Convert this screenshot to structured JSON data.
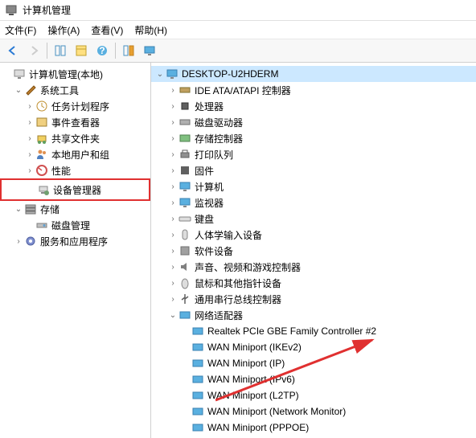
{
  "window": {
    "title": "计算机管理"
  },
  "menu": {
    "file": "文件(F)",
    "action": "操作(A)",
    "view": "查看(V)",
    "help": "帮助(H)"
  },
  "left_tree": {
    "root": "计算机管理(本地)",
    "system_tools": "系统工具",
    "task_scheduler": "任务计划程序",
    "event_viewer": "事件查看器",
    "shared_folders": "共享文件夹",
    "local_users": "本地用户和组",
    "performance": "性能",
    "device_manager": "设备管理器",
    "storage": "存储",
    "disk_management": "磁盘管理",
    "services": "服务和应用程序"
  },
  "right_tree": {
    "computer": "DESKTOP-U2HDERM",
    "ide": "IDE ATA/ATAPI 控制器",
    "processors": "处理器",
    "disk_drives": "磁盘驱动器",
    "storage_controllers": "存储控制器",
    "print_queues": "打印队列",
    "firmware": "固件",
    "computers": "计算机",
    "monitors": "监视器",
    "keyboards": "键盘",
    "hid": "人体学输入设备",
    "software_devices": "软件设备",
    "audio": "声音、视频和游戏控制器",
    "mice": "鼠标和其他指针设备",
    "usb": "通用串行总线控制器",
    "network_adapters": "网络适配器",
    "na0": "Realtek PCIe GBE Family Controller #2",
    "na1": "WAN Miniport (IKEv2)",
    "na2": "WAN Miniport (IP)",
    "na3": "WAN Miniport (IPv6)",
    "na4": "WAN Miniport (L2TP)",
    "na5": "WAN Miniport (Network Monitor)",
    "na6": "WAN Miniport (PPPOE)"
  }
}
